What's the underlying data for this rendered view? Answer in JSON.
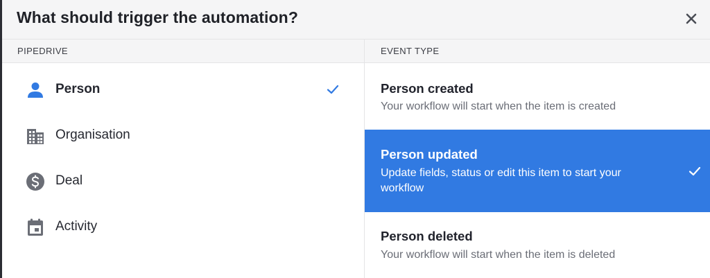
{
  "modal": {
    "title": "What should trigger the automation?",
    "close_icon": "close-icon"
  },
  "columns": {
    "left_header": "PIPEDRIVE",
    "right_header": "EVENT TYPE"
  },
  "entities": [
    {
      "label": "Person",
      "icon": "person-icon",
      "selected": true
    },
    {
      "label": "Organisation",
      "icon": "building-icon",
      "selected": false
    },
    {
      "label": "Deal",
      "icon": "dollar-coin-icon",
      "selected": false
    },
    {
      "label": "Activity",
      "icon": "calendar-icon",
      "selected": false
    }
  ],
  "events": [
    {
      "title": "Person created",
      "description": "Your workflow will start when the item is created",
      "selected": false
    },
    {
      "title": "Person updated",
      "description": "Update fields, status or edit this item to start your workflow",
      "selected": true
    },
    {
      "title": "Person deleted",
      "description": "Your workflow will start when the item is deleted",
      "selected": false
    }
  ],
  "colors": {
    "accent": "#317ae2",
    "header_bg": "#f5f5f6",
    "icon_gray": "#6b6e76"
  }
}
